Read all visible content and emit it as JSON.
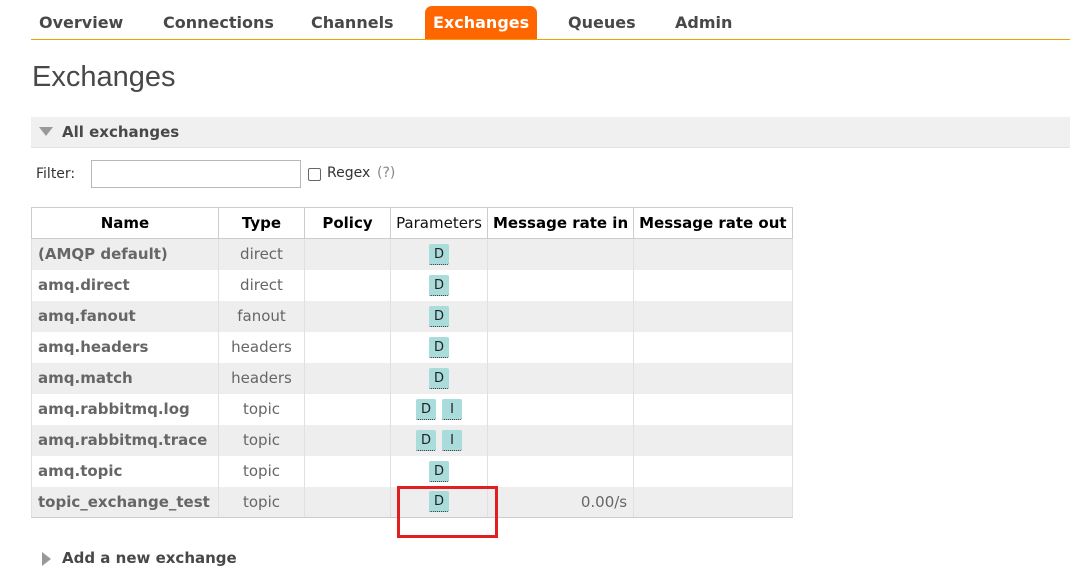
{
  "nav": {
    "items": [
      {
        "label": "Overview",
        "active": false
      },
      {
        "label": "Connections",
        "active": false
      },
      {
        "label": "Channels",
        "active": false
      },
      {
        "label": "Exchanges",
        "active": true
      },
      {
        "label": "Queues",
        "active": false
      },
      {
        "label": "Admin",
        "active": false
      }
    ]
  },
  "page": {
    "title": "Exchanges"
  },
  "section": {
    "label": "All exchanges",
    "expanded": true
  },
  "filter": {
    "label": "Filter:",
    "value": "",
    "regex_label": "Regex",
    "regex_checked": false,
    "regex_help": "(?)"
  },
  "table": {
    "headers": {
      "name": "Name",
      "type": "Type",
      "policy": "Policy",
      "parameters": "Parameters",
      "rate_in": "Message rate in",
      "rate_out": "Message rate out"
    },
    "rows": [
      {
        "name": "(AMQP default)",
        "type": "direct",
        "policy": "",
        "params": [
          "D"
        ],
        "rate_in": "",
        "rate_out": ""
      },
      {
        "name": "amq.direct",
        "type": "direct",
        "policy": "",
        "params": [
          "D"
        ],
        "rate_in": "",
        "rate_out": ""
      },
      {
        "name": "amq.fanout",
        "type": "fanout",
        "policy": "",
        "params": [
          "D"
        ],
        "rate_in": "",
        "rate_out": ""
      },
      {
        "name": "amq.headers",
        "type": "headers",
        "policy": "",
        "params": [
          "D"
        ],
        "rate_in": "",
        "rate_out": ""
      },
      {
        "name": "amq.match",
        "type": "headers",
        "policy": "",
        "params": [
          "D"
        ],
        "rate_in": "",
        "rate_out": ""
      },
      {
        "name": "amq.rabbitmq.log",
        "type": "topic",
        "policy": "",
        "params": [
          "D",
          "I"
        ],
        "rate_in": "",
        "rate_out": ""
      },
      {
        "name": "amq.rabbitmq.trace",
        "type": "topic",
        "policy": "",
        "params": [
          "D",
          "I"
        ],
        "rate_in": "",
        "rate_out": ""
      },
      {
        "name": "amq.topic",
        "type": "topic",
        "policy": "",
        "params": [
          "D"
        ],
        "rate_in": "",
        "rate_out": ""
      },
      {
        "name": "topic_exchange_test",
        "type": "topic",
        "policy": "",
        "params": [
          "D"
        ],
        "rate_in": "0.00/s",
        "rate_out": ""
      }
    ]
  },
  "add_section": {
    "label": "Add a new exchange"
  },
  "colors": {
    "nav_active_bg": "#ff6600",
    "nav_underline": "#f0a000",
    "badge_bg": "#aadcdc",
    "highlight_border": "#e02020"
  }
}
